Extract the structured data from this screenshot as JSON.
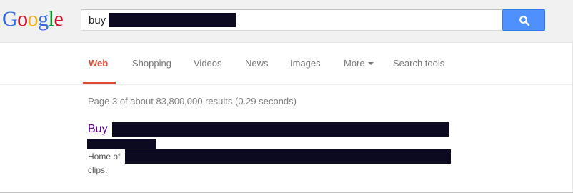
{
  "logo": {
    "letters": [
      "G",
      "o",
      "o",
      "g",
      "l",
      "e"
    ],
    "colors": [
      "#3369e8",
      "#d50f25",
      "#eeb211",
      "#3369e8",
      "#009925",
      "#d50f25"
    ]
  },
  "search": {
    "query": "buy",
    "button_icon": "search-icon",
    "button_color": "#4d90fe"
  },
  "nav": {
    "tabs": [
      {
        "label": "Web",
        "active": true
      },
      {
        "label": "Shopping"
      },
      {
        "label": "Videos"
      },
      {
        "label": "News"
      },
      {
        "label": "Images"
      },
      {
        "label": "More"
      },
      {
        "label": "Search tools"
      }
    ],
    "active_color": "#dd4b39"
  },
  "results": {
    "stats": "Page 3 of about 83,800,000 results (0.29 seconds)",
    "items": [
      {
        "title": "Buy",
        "snippet_start": "Home of",
        "snippet_end": "clips."
      }
    ]
  }
}
